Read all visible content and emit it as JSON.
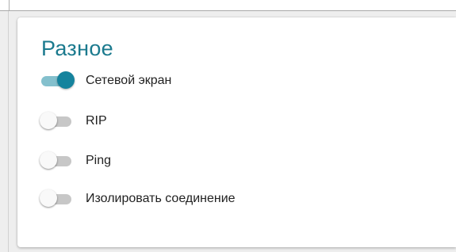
{
  "section": {
    "title": "Разное",
    "toggles": [
      {
        "label": "Сетевой экран",
        "checked": true
      },
      {
        "label": "RIP",
        "checked": false
      },
      {
        "label": "Ping",
        "checked": false
      },
      {
        "label": "Изолировать соединение",
        "checked": false
      }
    ]
  },
  "colors": {
    "title": "#1b7a8e",
    "toggle_on_knob": "#15839d",
    "toggle_on_track": "#84c0cd",
    "toggle_off_knob": "#f9f9f9",
    "toggle_off_track": "#c7c7c7"
  }
}
